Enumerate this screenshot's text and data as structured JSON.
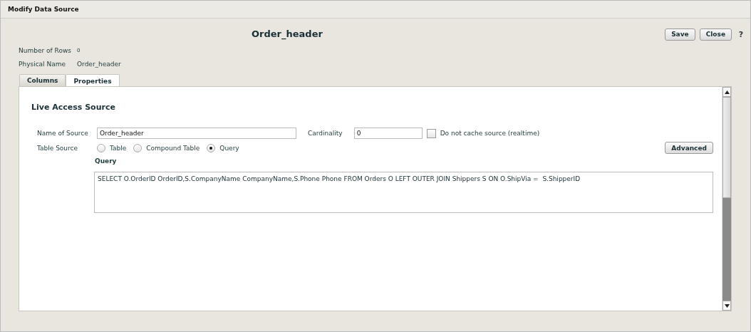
{
  "window": {
    "title": "Modify Data Source"
  },
  "header": {
    "title": "Order_header",
    "buttons": [
      "Save",
      "Close"
    ],
    "help": "?"
  },
  "info": [
    {
      "label": "Number of Rows",
      "value": "0"
    },
    {
      "label": "Physical Name",
      "value": "Order_header"
    }
  ],
  "tabs": [
    {
      "label": "Columns",
      "selected": false
    },
    {
      "label": "Properties",
      "selected": true
    }
  ],
  "section": {
    "title": "Live Access Source"
  },
  "form": {
    "name_label": "Name of Source",
    "name_value": "Order_header",
    "cardinality_label": "Cardinality",
    "cardinality_value": "0",
    "no_cache": {
      "label": "Do not cache source (realtime)",
      "checked": false
    },
    "table_source_label": "Table Source",
    "table_source_options": [
      {
        "label": "Table",
        "selected": false
      },
      {
        "label": "Compound Table",
        "selected": false
      },
      {
        "label": "Query",
        "selected": true
      }
    ],
    "advanced_button": "Advanced",
    "query_label": "Query",
    "query_value": "SELECT O.OrderID OrderID,S.CompanyName CompanyName,S.Phone Phone FROM Orders O LEFT OUTER JOIN Shippers S ON O.ShipVia =  S.ShipperID"
  }
}
